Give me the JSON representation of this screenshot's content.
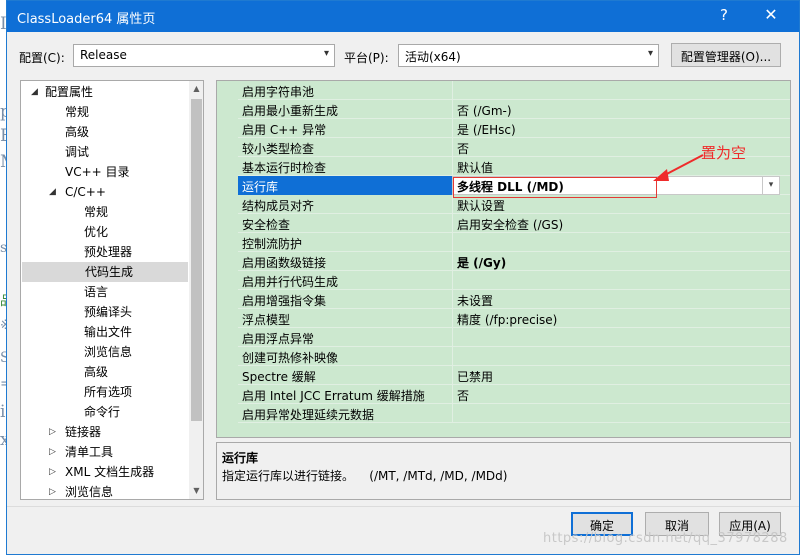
{
  "window": {
    "title": "ClassLoader64 属性页",
    "help_glyph": "?",
    "close_glyph": "✕"
  },
  "toolbar": {
    "config_label": "配置(C):",
    "config_value": "Release",
    "platform_label": "平台(P):",
    "platform_value": "活动(x64)",
    "config_manager_label": "配置管理器(O)..."
  },
  "tree": {
    "items": [
      {
        "label": "配置属性",
        "toggle": "◢"
      },
      {
        "label": "常规"
      },
      {
        "label": "高级"
      },
      {
        "label": "调试"
      },
      {
        "label": "VC++ 目录"
      },
      {
        "label": "C/C++",
        "toggle": "◢"
      },
      {
        "label": "常规"
      },
      {
        "label": "优化"
      },
      {
        "label": "预处理器"
      },
      {
        "label": "代码生成",
        "selected": true
      },
      {
        "label": "语言"
      },
      {
        "label": "预编译头"
      },
      {
        "label": "输出文件"
      },
      {
        "label": "浏览信息"
      },
      {
        "label": "高级"
      },
      {
        "label": "所有选项"
      },
      {
        "label": "命令行"
      },
      {
        "label": "链接器",
        "toggle": "▷"
      },
      {
        "label": "清单工具",
        "toggle": "▷"
      },
      {
        "label": "XML 文档生成器",
        "toggle": "▷"
      },
      {
        "label": "浏览信息",
        "toggle": "▷"
      }
    ]
  },
  "properties": [
    {
      "name": "启用字符串池",
      "value": ""
    },
    {
      "name": "启用最小重新生成",
      "value": "否 (/Gm-)"
    },
    {
      "name": "启用 C++ 异常",
      "value": "是 (/EHsc)"
    },
    {
      "name": "较小类型检查",
      "value": "否"
    },
    {
      "name": "基本运行时检查",
      "value": "默认值"
    },
    {
      "name": "运行库",
      "value": "多线程 DLL (/MD)",
      "selected": true
    },
    {
      "name": "结构成员对齐",
      "value": "默认设置"
    },
    {
      "name": "安全检查",
      "value": "启用安全检查 (/GS)"
    },
    {
      "name": "控制流防护",
      "value": ""
    },
    {
      "name": "启用函数级链接",
      "value": "是 (/Gy)",
      "bold": true
    },
    {
      "name": "启用并行代码生成",
      "value": ""
    },
    {
      "name": "启用增强指令集",
      "value": "未设置"
    },
    {
      "name": "浮点模型",
      "value": "精度 (/fp:precise)"
    },
    {
      "name": "启用浮点异常",
      "value": ""
    },
    {
      "name": "创建可热修补映像",
      "value": ""
    },
    {
      "name": "Spectre 缓解",
      "value": "已禁用"
    },
    {
      "name": "启用 Intel JCC Erratum 缓解措施",
      "value": "否"
    },
    {
      "name": "启用异常处理延续元数据",
      "value": ""
    }
  ],
  "annotation": {
    "text": "置为空",
    "color": "#ef2b2b"
  },
  "description": {
    "title": "运行库",
    "text": "指定运行库以进行链接。    (/MT, /MTd, /MD, /MDd)"
  },
  "buttons": {
    "ok": "确定",
    "cancel": "取消",
    "apply": "应用(A)"
  },
  "watermark": "https://blog.csdn.net/qq_37978288",
  "background_glyphs": [
    "I",
    "p",
    "E",
    "M",
    "s",
    "品",
    "※",
    "S",
    "=",
    "i",
    "x"
  ],
  "colors": {
    "titlebar": "#0f6fd6",
    "grid_bg": "#cce8cf",
    "selection": "#0f6fd6"
  }
}
